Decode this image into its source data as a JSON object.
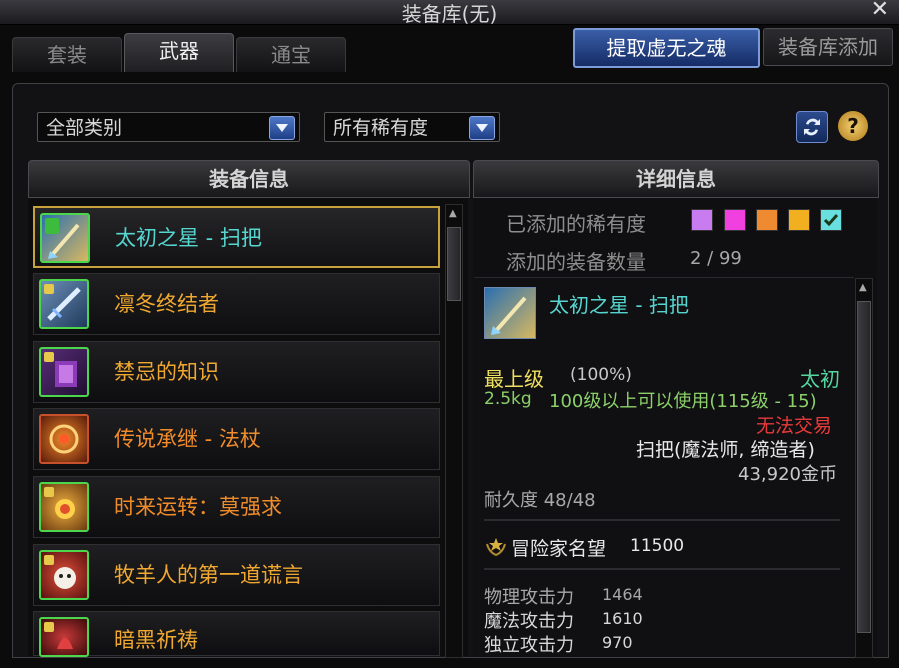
{
  "window": {
    "title": "装备库(无)",
    "close_glyph": "✕"
  },
  "tabs": [
    {
      "label": "套装",
      "active": false
    },
    {
      "label": "武器",
      "active": true
    },
    {
      "label": "通宝",
      "active": false
    }
  ],
  "buttons": {
    "extract": "提取虚无之魂",
    "add": "装备库添加"
  },
  "filters": {
    "category": "全部类别",
    "rarity": "所有稀有度"
  },
  "panels": {
    "left_header": "装备信息",
    "right_header": "详细信息"
  },
  "items": [
    {
      "name": "太初之星 - 扫把",
      "color": "#56d6d0",
      "selected": true,
      "icon": "broom-icon"
    },
    {
      "name": "凛冬终结者",
      "color": "#f0a830",
      "selected": false,
      "icon": "ice-blade-icon"
    },
    {
      "name": "禁忌的知识",
      "color": "#f0a830",
      "selected": false,
      "icon": "forbidden-book-icon"
    },
    {
      "name": "传说承继 - 法杖",
      "color": "#f08c2a",
      "selected": false,
      "icon": "flame-staff-icon"
    },
    {
      "name": "时来运转：莫强求",
      "color": "#f08c2a",
      "selected": false,
      "icon": "sun-charm-icon"
    },
    {
      "name": "牧羊人的第一道谎言",
      "color": "#f0a830",
      "selected": false,
      "icon": "sheep-icon"
    },
    {
      "name": "暗黑祈祷",
      "color": "#f0a830",
      "selected": false,
      "icon": "dark-prayer-icon"
    }
  ],
  "detail": {
    "rarity_label": "已添加的稀有度",
    "rarity_colors": [
      "#c87cf0",
      "#f040e0",
      "#f08a30",
      "#f0b020",
      "#6adfe0"
    ],
    "count_label": "添加的装备数量",
    "count_value": "2 / 99",
    "item_name": "太初之星 - 扫把",
    "grade": "最上级",
    "grade_pct": "(100%)",
    "tier": "太初",
    "weight": "2.5kg",
    "level_req": "100级以上可以使用(115级 - 15)",
    "trade": "无法交易",
    "type": "扫把(魔法师, 缔造者)",
    "price": "43,920金币",
    "durability": "耐久度 48/48",
    "fame_label": "冒险家名望",
    "fame_value": "11500",
    "stats": [
      {
        "label": "物理攻击力",
        "value": "1464"
      },
      {
        "label": "魔法攻击力",
        "value": "1610"
      },
      {
        "label": "独立攻击力",
        "value": "970"
      }
    ]
  }
}
